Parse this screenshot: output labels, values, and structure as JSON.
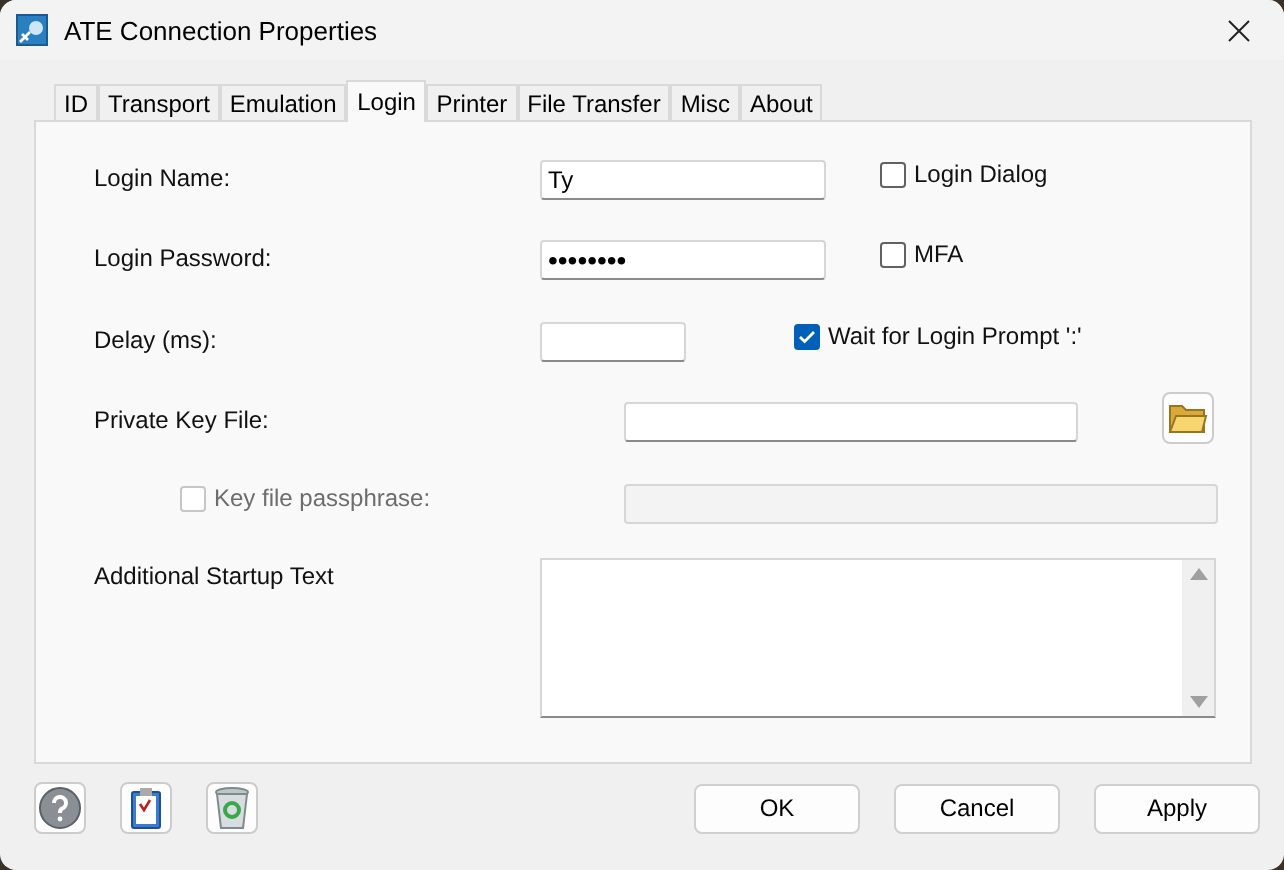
{
  "window": {
    "title": "ATE Connection Properties"
  },
  "tabs": [
    {
      "label": "ID",
      "selected": false
    },
    {
      "label": "Transport",
      "selected": false
    },
    {
      "label": "Emulation",
      "selected": false
    },
    {
      "label": "Login",
      "selected": true
    },
    {
      "label": "Printer",
      "selected": false
    },
    {
      "label": "File Transfer",
      "selected": false
    },
    {
      "label": "Misc",
      "selected": false
    },
    {
      "label": "About",
      "selected": false
    }
  ],
  "login_name": {
    "label": "Login Name:",
    "value": "Ty"
  },
  "login_dialog": {
    "label": "Login Dialog",
    "checked": false
  },
  "login_password": {
    "label": "Login Password:",
    "value": "••••••••"
  },
  "mfa": {
    "label": "MFA",
    "checked": false
  },
  "delay": {
    "label": "Delay (ms):"
  },
  "wait_for_prompt": {
    "label": "Wait for Login Prompt ':'",
    "checked": true
  },
  "private_key_file": {
    "label": "Private Key File:"
  },
  "key_file_passphrase": {
    "label": "Key file passphrase:",
    "checked": false,
    "disabled": true
  },
  "additional_startup_text": {
    "label": "Additional Startup Text"
  },
  "buttons": [
    "OK",
    "Cancel",
    "Apply"
  ]
}
